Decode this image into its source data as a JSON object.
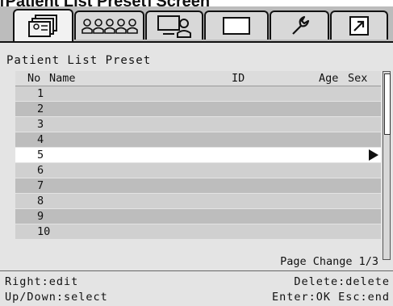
{
  "heading": "[Patient List Preset] Screen",
  "tabs": [
    {
      "icon": "patient-list-icon",
      "active": true
    },
    {
      "icon": "people-icon",
      "active": false
    },
    {
      "icon": "computer-user-icon",
      "active": false
    },
    {
      "icon": "blank-screen-icon",
      "active": false
    },
    {
      "icon": "wrench-icon",
      "active": false
    },
    {
      "icon": "arrow-out-icon",
      "active": false
    }
  ],
  "screen_title": "Patient List Preset",
  "columns": {
    "no": "No",
    "name": "Name",
    "id": "ID",
    "age": "Age",
    "sex": "Sex"
  },
  "rows": [
    "1",
    "2",
    "3",
    "4",
    "5",
    "6",
    "7",
    "8",
    "9",
    "10"
  ],
  "selected_row": "5",
  "pager": "Page Change 1/3",
  "footer": {
    "left1": "Right:edit",
    "right1": "Delete:delete",
    "left2": "Up/Down:select",
    "right2": "Enter:OK Esc:end"
  }
}
